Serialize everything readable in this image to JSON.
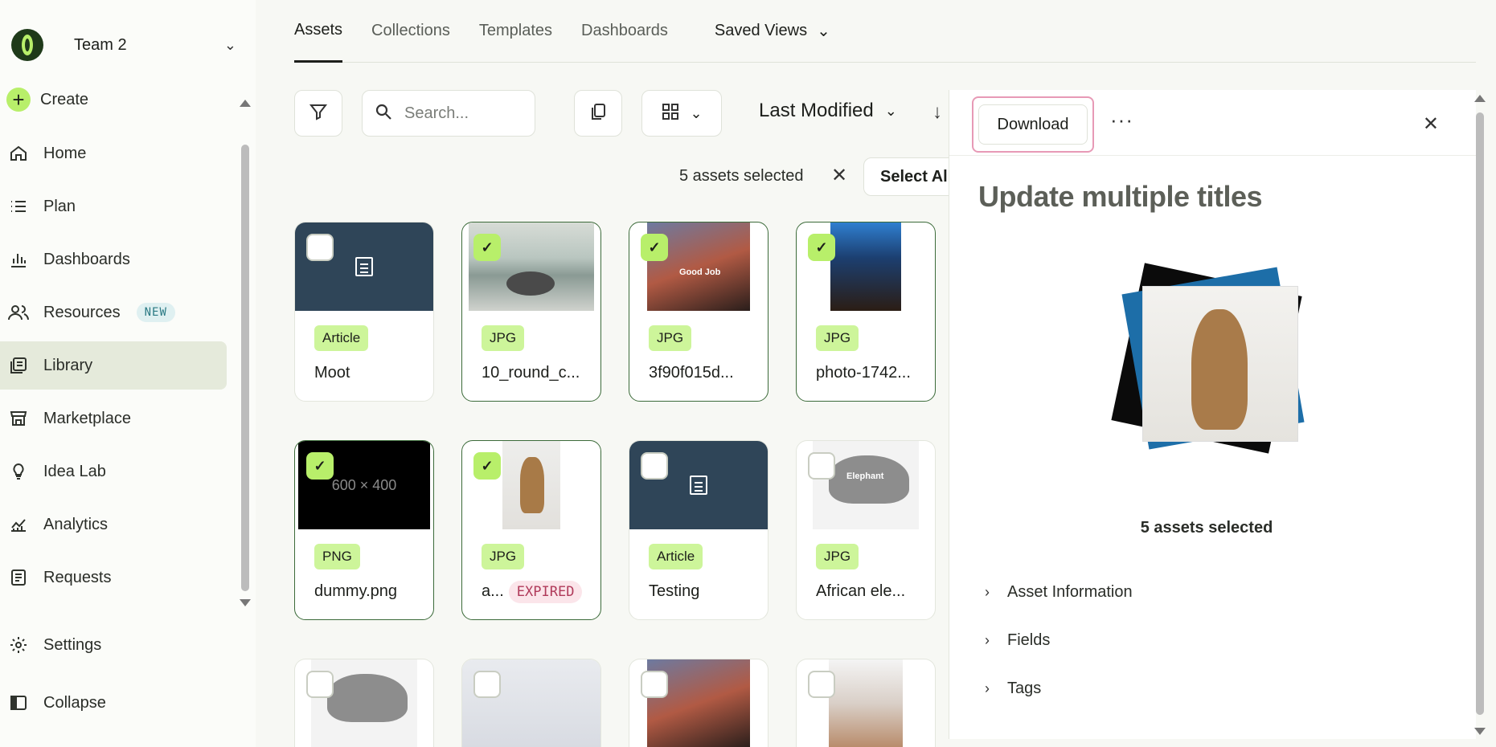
{
  "sidebar": {
    "team_name": "Team 2",
    "items": [
      {
        "label": "Create",
        "icon": "plus-icon"
      },
      {
        "label": "Home",
        "icon": "home-icon"
      },
      {
        "label": "Plan",
        "icon": "list-icon"
      },
      {
        "label": "Dashboards",
        "icon": "bar-chart-icon"
      },
      {
        "label": "Resources",
        "icon": "users-icon",
        "badge": "NEW"
      },
      {
        "label": "Library",
        "icon": "library-icon"
      },
      {
        "label": "Marketplace",
        "icon": "store-icon"
      },
      {
        "label": "Idea Lab",
        "icon": "lightbulb-icon"
      },
      {
        "label": "Analytics",
        "icon": "line-chart-icon"
      },
      {
        "label": "Requests",
        "icon": "clipboard-icon"
      },
      {
        "label": "Settings",
        "icon": "gear-icon"
      },
      {
        "label": "Collapse",
        "icon": "collapse-icon"
      }
    ]
  },
  "tabs": [
    "Assets",
    "Collections",
    "Templates",
    "Dashboards"
  ],
  "saved_views": "Saved Views",
  "search": {
    "placeholder": "Search..."
  },
  "sort": {
    "label": "Last Modified"
  },
  "selection": {
    "count_text": "5 assets selected",
    "select_all": "Select All"
  },
  "assets": [
    {
      "type": "Article",
      "title": "Moot",
      "selected": false
    },
    {
      "type": "JPG",
      "title": "10_round_c...",
      "selected": true
    },
    {
      "type": "JPG",
      "title": "3f90f015d...",
      "selected": true,
      "overlay": "Good Job"
    },
    {
      "type": "JPG",
      "title": "photo-1742...",
      "selected": true
    },
    {
      "type": "PNG",
      "title": "dummy.png",
      "selected": true,
      "overlay": "600 × 400"
    },
    {
      "type": "JPG",
      "title": "a...",
      "selected": true,
      "status": "EXPIRED"
    },
    {
      "type": "Article",
      "title": "Testing",
      "selected": false
    },
    {
      "type": "JPG",
      "title": "African ele...",
      "selected": false,
      "overlay": "Elephant"
    }
  ],
  "panel": {
    "download": "Download",
    "more": "···",
    "title": "Update multiple titles",
    "count": "5 assets selected",
    "sections": [
      "Asset Information",
      "Fields",
      "Tags"
    ]
  },
  "colors": {
    "accent": "#b8ef6a",
    "active_nav": "#e5eadb",
    "article_thumb": "#2f4558",
    "download_highlight": "#e79ab6"
  }
}
